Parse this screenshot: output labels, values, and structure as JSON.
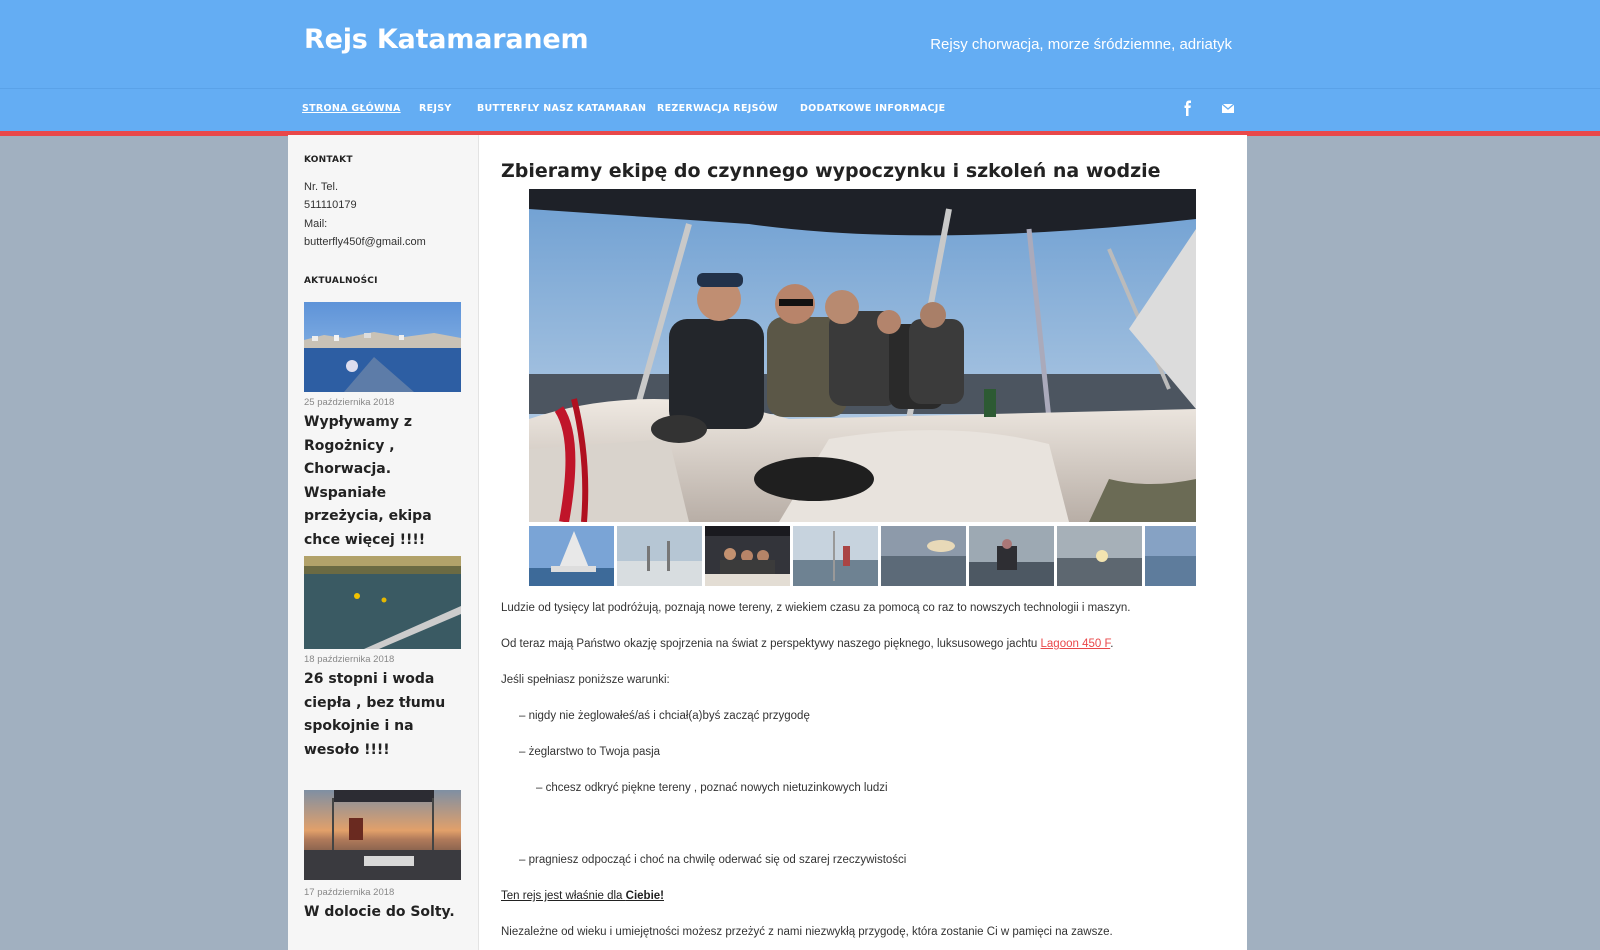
{
  "header": {
    "site_title": "Rejs Katamaranem",
    "tagline": "Rejsy chorwacja, morze śródziemne, adriatyk"
  },
  "nav": {
    "items": [
      {
        "label": "STRONA GŁÓWNA"
      },
      {
        "label": "REJSY"
      },
      {
        "label": "BUTTERFLY NASZ KATAMARAN"
      },
      {
        "label": "REZERWACJA REJSÓW"
      },
      {
        "label": "DODATKOWE INFORMACJE"
      }
    ],
    "social": [
      "facebook-icon",
      "mail-icon"
    ]
  },
  "sidebar": {
    "contact": {
      "title": "KONTAKT",
      "phone_label": "Nr. Tel.",
      "phone": "511110179",
      "mail_label": "Mail:",
      "mail": "butterfly450f@gmail.com"
    },
    "news_title": "AKTUALNOŚCI",
    "posts": [
      {
        "date": "25 października 2018",
        "title": "Wypływamy z Rogożnicy , Chorwacja. Wspaniałe przeżycia, ekipa chce więcej !!!!"
      },
      {
        "date": "18 października 2018",
        "title": "26 stopni i woda ciepła , bez tłumu spokojnie i na wesoło !!!!"
      },
      {
        "date": "17 października 2018",
        "title": "W dolocie do Solty."
      }
    ]
  },
  "main": {
    "title": "Zbieramy ekipę do czynnego wypoczynku i szkoleń na wodzie",
    "para1": "Ludzie od tysięcy lat podróżują, poznają nowe tereny, z wiekiem czasu za pomocą co raz to nowszych technologii i maszyn.",
    "para2_before": "Od teraz mają Państwo okazję spojrzenia na świat z perspektywy naszego pięknego, luksusowego jachtu ",
    "para2_link": "Lagoon 450 F",
    "para2_after": ".",
    "para3": "Jeśli spełniasz poniższe warunki:",
    "item1": "– nigdy nie żeglowałeś/aś i chciał(a)byś zacząć przygodę",
    "item2": "– żeglarstwo to Twoja pasja",
    "item3": "– chcesz odkryć piękne tereny , poznać nowych nietuzinkowych ludzi",
    "item4": "– pragniesz odpocząć i choć na chwilę oderwać się od szarej rzeczywistości",
    "cta_before": "Ten rejs jest właśnie dla ",
    "cta_bold": "Ciebie!",
    "para_last": "Niezależne od wieku i umiejętności możesz przeżyć z nami niezwykłą przygodę, która zostanie Ci w pamięci na zawsze."
  },
  "colors": {
    "header": "#64adf3",
    "accent": "#e9484a",
    "background": "#a1b0c0"
  }
}
